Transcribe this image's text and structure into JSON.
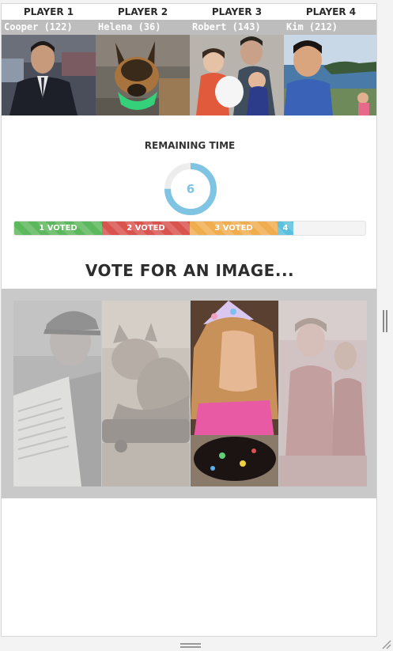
{
  "players": [
    {
      "title": "PLAYER 1",
      "name": "Cooper (122)",
      "photo": "man-in-suit-photo"
    },
    {
      "title": "PLAYER 2",
      "name": "Helena (36)",
      "photo": "dog-photo"
    },
    {
      "title": "PLAYER 3",
      "name": "Robert (143)",
      "photo": "family-photo"
    },
    {
      "title": "PLAYER 4",
      "name": "Kim (212)",
      "photo": "lake-selfie-photo"
    }
  ],
  "timer": {
    "label": "REMAINING TIME",
    "value": "6",
    "fraction": 0.75,
    "color": "#7fc4e2"
  },
  "progress": {
    "segments": [
      {
        "label": "1 VOTED",
        "share": 0.25,
        "color": "#5cb85c"
      },
      {
        "label": "2 VOTED",
        "share": 0.25,
        "color": "#d9534f"
      },
      {
        "label": "3 VOTED",
        "share": 0.25,
        "color": "#f0ad4e"
      },
      {
        "label": "4",
        "share": 0.045,
        "color": "#5bc0de"
      }
    ]
  },
  "vote": {
    "heading": "VOTE FOR AN IMAGE...",
    "images": [
      {
        "subject": "old-man-newspaper-image",
        "selected": false
      },
      {
        "subject": "cat-on-skateboard-image",
        "selected": false
      },
      {
        "subject": "child-birthday-cake-image",
        "selected": true
      },
      {
        "subject": "mud-run-women-image",
        "selected": false
      }
    ]
  }
}
